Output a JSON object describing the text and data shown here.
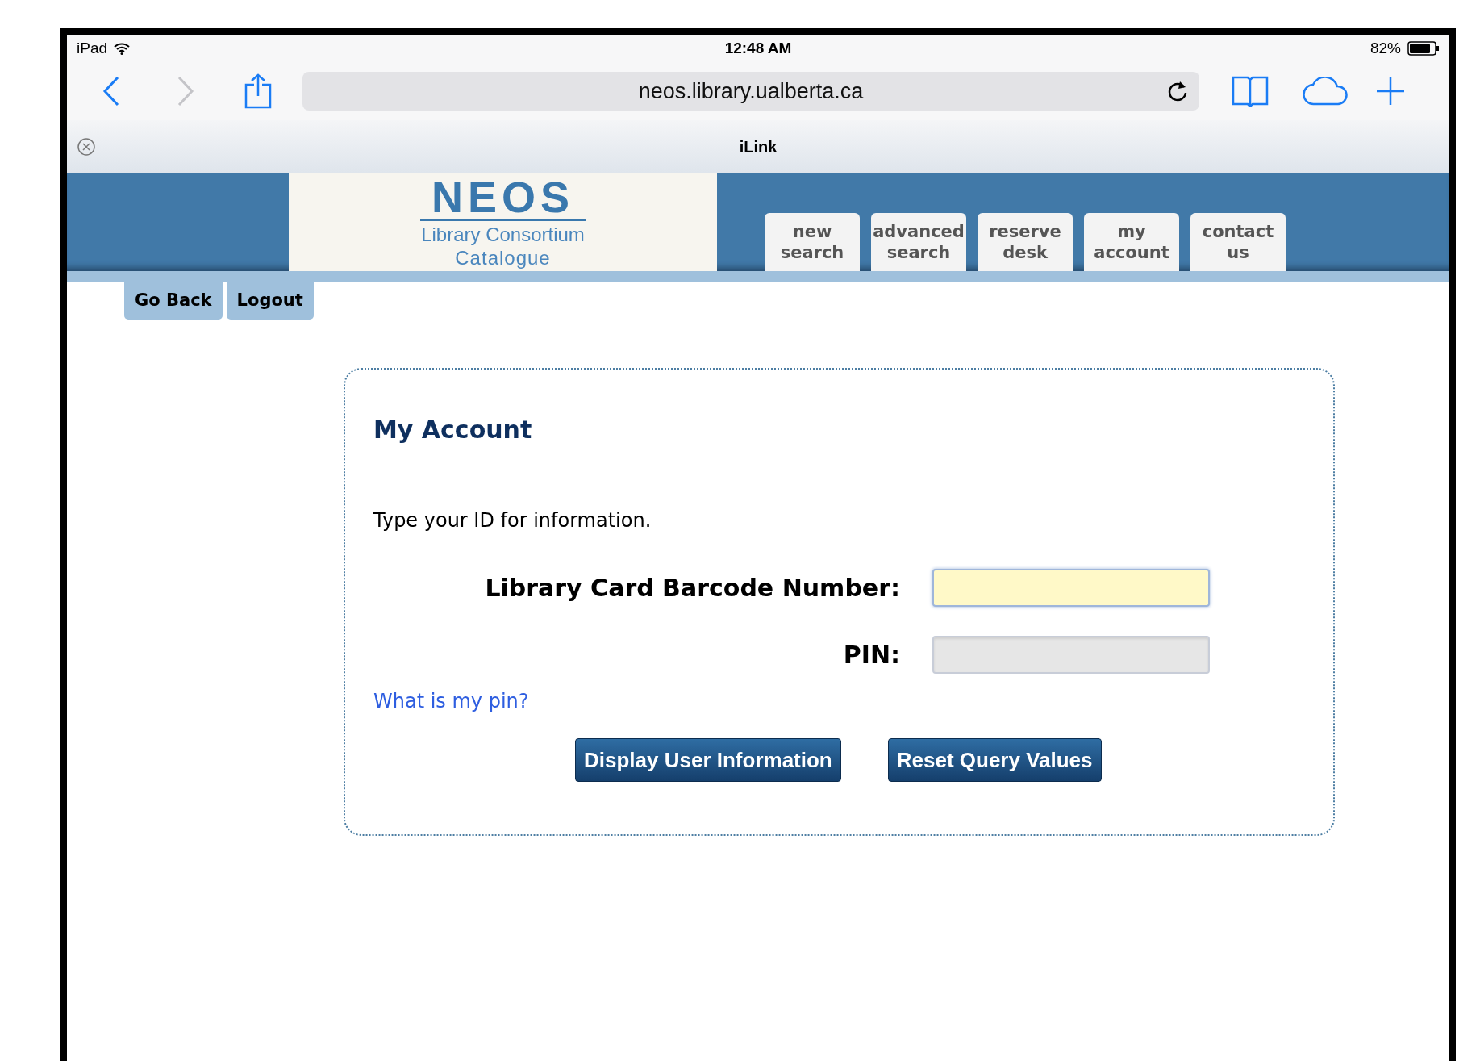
{
  "status_bar": {
    "device": "iPad",
    "time": "12:48 AM",
    "battery_text": "82%"
  },
  "browser": {
    "url": "neos.library.ualberta.ca",
    "tab_title": "iLink",
    "back_enabled": true,
    "forward_enabled": false
  },
  "banner": {
    "logo_title": "NEOS",
    "logo_subtitle_1": "Library Consortium",
    "logo_subtitle_2": "Catalogue"
  },
  "nav_tabs": [
    {
      "line_1": "new",
      "line_2": "search"
    },
    {
      "line_1": "advanced",
      "line_2": "search"
    },
    {
      "line_1": "reserve",
      "line_2": "desk"
    },
    {
      "line_1": "my",
      "line_2": "account"
    },
    {
      "line_1": "contact",
      "line_2": "us"
    }
  ],
  "sub_buttons": [
    "Go Back",
    "Logout"
  ],
  "form": {
    "title": "My Account",
    "instruction": "Type your ID for information.",
    "fields": [
      {
        "label": "Library Card Barcode Number:",
        "focused": true
      },
      {
        "label": "PIN:",
        "focused": false
      }
    ],
    "help_link": "What is my pin?",
    "buttons": [
      "Display User Information",
      "Reset Query Values"
    ]
  }
}
